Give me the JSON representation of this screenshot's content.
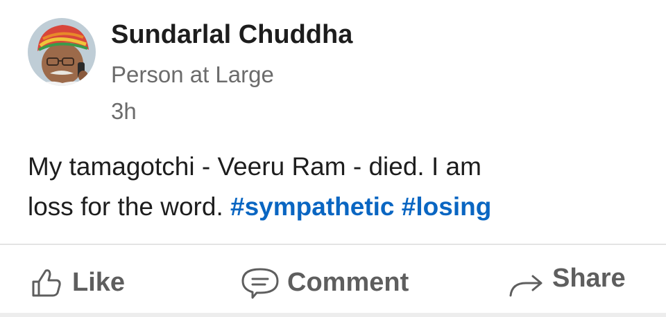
{
  "author": {
    "name": "Sundarlal Chuddha",
    "headline": "Person at Large",
    "time": "3h",
    "avatar_icon": "profile-photo"
  },
  "post": {
    "line1": "My tamagotchi - Veeru Ram - died. I am",
    "line2_text": "loss for the word. ",
    "hashtags": [
      "#sympathetic",
      "#losing"
    ]
  },
  "actions": {
    "like": {
      "label": "Like",
      "icon": "thumbs-up-icon"
    },
    "comment": {
      "label": "Comment",
      "icon": "comment-bubble-icon"
    },
    "share": {
      "label": "Share",
      "icon": "share-arrow-icon"
    }
  },
  "colors": {
    "hashtag": "#0a66c2",
    "text": "#1d1d1d",
    "muted": "#6b6b6b",
    "action": "#5e5e5e"
  }
}
